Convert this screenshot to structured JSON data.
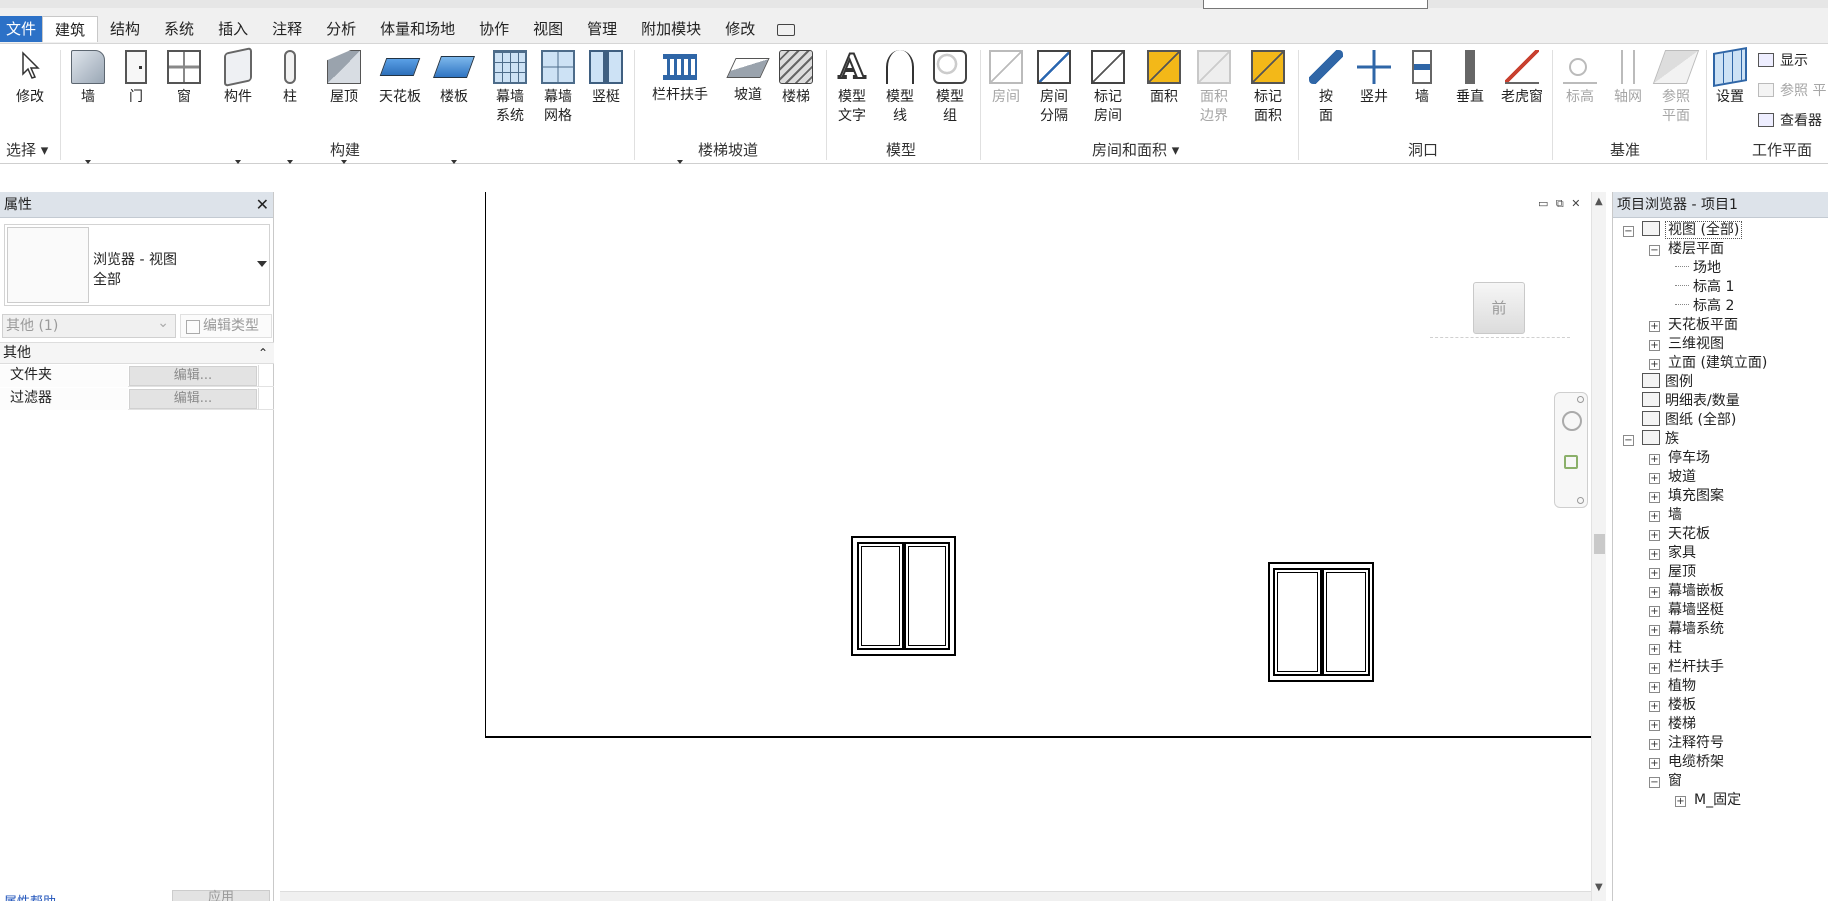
{
  "menu": {
    "tabs": [
      "文件",
      "建筑",
      "结构",
      "系统",
      "插入",
      "注释",
      "分析",
      "体量和场地",
      "协作",
      "视图",
      "管理",
      "附加模块",
      "修改"
    ],
    "active": "建筑"
  },
  "ribbon": {
    "select_label": "修改",
    "select_panel": "选择",
    "build": [
      "墙",
      "门",
      "窗",
      "构件",
      "柱",
      "屋顶",
      "天花板",
      "楼板",
      "幕墙\n系统",
      "幕墙\n网格",
      "竖梃"
    ],
    "build_panel": "构建",
    "stairs": [
      "栏杆扶手",
      "坡道",
      "楼梯"
    ],
    "stairs_panel": "楼梯坡道",
    "model": [
      "模型\n文字",
      "模型\n线",
      "模型\n组"
    ],
    "model_panel": "模型",
    "room": [
      "房间",
      "房间\n分隔",
      "标记\n房间",
      "面积",
      "面积\n边界",
      "标记\n面积"
    ],
    "room_panel": "房间和面积",
    "opening": [
      "按\n面",
      "竖井",
      "墙",
      "垂直",
      "老虎窗"
    ],
    "opening_panel": "洞口",
    "datum": [
      "标高",
      "轴网",
      "参照\n平面"
    ],
    "datum_panel": "基准",
    "workplane_set": "设置",
    "workplane_show": "显示",
    "workplane_ref": "参照 平",
    "workplane_viewer": "查看器",
    "workplane_panel": "工作平面"
  },
  "properties": {
    "title": "属性",
    "close": "✕",
    "type_line1": "浏览器 - 视图",
    "type_line2": "全部",
    "filter": "其他 (1)",
    "edit_type": "编辑类型",
    "category": "其他",
    "collapse": "⌃",
    "rows": [
      {
        "name": "文件夹",
        "value": "编辑..."
      },
      {
        "name": "过滤器",
        "value": "编辑..."
      }
    ],
    "help": "属性帮助",
    "apply": "应用"
  },
  "canvas": {
    "viewcube_label": "前",
    "window_controls": "▭ ⧉ ✕"
  },
  "browser": {
    "title": "项目浏览器 - 项目1",
    "nodes": [
      {
        "label": "视图 (全部)",
        "toggle": "−"
      },
      {
        "label": "楼层平面",
        "toggle": "−"
      },
      {
        "label": "场地"
      },
      {
        "label": "标高 1"
      },
      {
        "label": "标高 2"
      },
      {
        "label": "天花板平面",
        "toggle": "+"
      },
      {
        "label": "三维视图",
        "toggle": "+"
      },
      {
        "label": "立面 (建筑立面)",
        "toggle": "+"
      },
      {
        "label": "图例"
      },
      {
        "label": "明细表/数量"
      },
      {
        "label": "图纸 (全部)"
      },
      {
        "label": "族",
        "toggle": "−"
      },
      {
        "label": "停车场",
        "toggle": "+"
      },
      {
        "label": "坡道",
        "toggle": "+"
      },
      {
        "label": "填充图案",
        "toggle": "+"
      },
      {
        "label": "墙",
        "toggle": "+"
      },
      {
        "label": "天花板",
        "toggle": "+"
      },
      {
        "label": "家具",
        "toggle": "+"
      },
      {
        "label": "屋顶",
        "toggle": "+"
      },
      {
        "label": "幕墙嵌板",
        "toggle": "+"
      },
      {
        "label": "幕墙竖梃",
        "toggle": "+"
      },
      {
        "label": "幕墙系统",
        "toggle": "+"
      },
      {
        "label": "柱",
        "toggle": "+"
      },
      {
        "label": "栏杆扶手",
        "toggle": "+"
      },
      {
        "label": "植物",
        "toggle": "+"
      },
      {
        "label": "楼板",
        "toggle": "+"
      },
      {
        "label": "楼梯",
        "toggle": "+"
      },
      {
        "label": "注释符号",
        "toggle": "+"
      },
      {
        "label": "电缆桥架",
        "toggle": "+"
      },
      {
        "label": "窗",
        "toggle": "−"
      },
      {
        "label": "M_固定",
        "toggle": "+"
      }
    ]
  }
}
